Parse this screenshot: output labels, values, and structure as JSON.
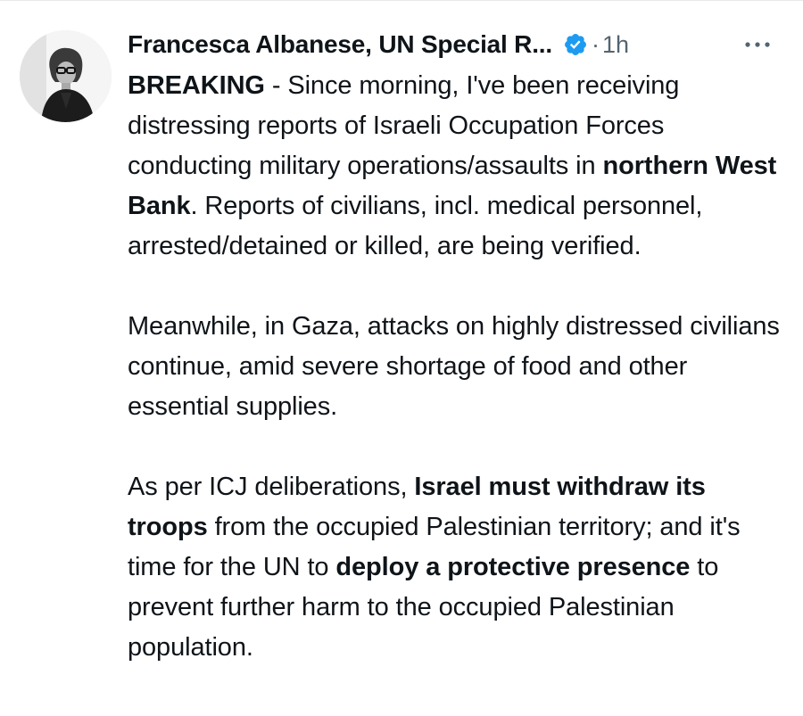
{
  "tweet": {
    "author_name": "Francesca Albanese, UN Special R...",
    "verified": true,
    "separator": "·",
    "timestamp": "1h",
    "more_label": "More",
    "paragraphs": [
      {
        "p1_bold_breaking": "BREAKING",
        "p1_text_a": " - Since morning, I've been receiving distressing reports of Israeli Occupation Forces conducting military operations/assaults in ",
        "p1_bold_region": "northern West Bank",
        "p1_text_b": ". Reports of civilians, incl. medical personnel, arrested/detained or killed, are being verified."
      },
      {
        "p2_text": "Meanwhile, in Gaza, attacks on highly distressed civilians continue, amid severe shortage of food and other essential supplies."
      },
      {
        "p3_text_a": "As per ICJ deliberations, ",
        "p3_bold_a": "Israel must withdraw its troops",
        "p3_text_b": " from the occupied Palestinian territory; and it's time for the UN to ",
        "p3_bold_b": "deploy a protective presence",
        "p3_text_c": " to prevent further harm to the occupied Palestinian population."
      }
    ]
  },
  "colors": {
    "text_primary": "#0f1419",
    "text_secondary": "#536471",
    "verified_blue": "#1d9bf0",
    "divider": "#e7e9ea"
  },
  "icons": {
    "verified": "verified-badge-icon",
    "more": "more-horizontal-icon"
  }
}
